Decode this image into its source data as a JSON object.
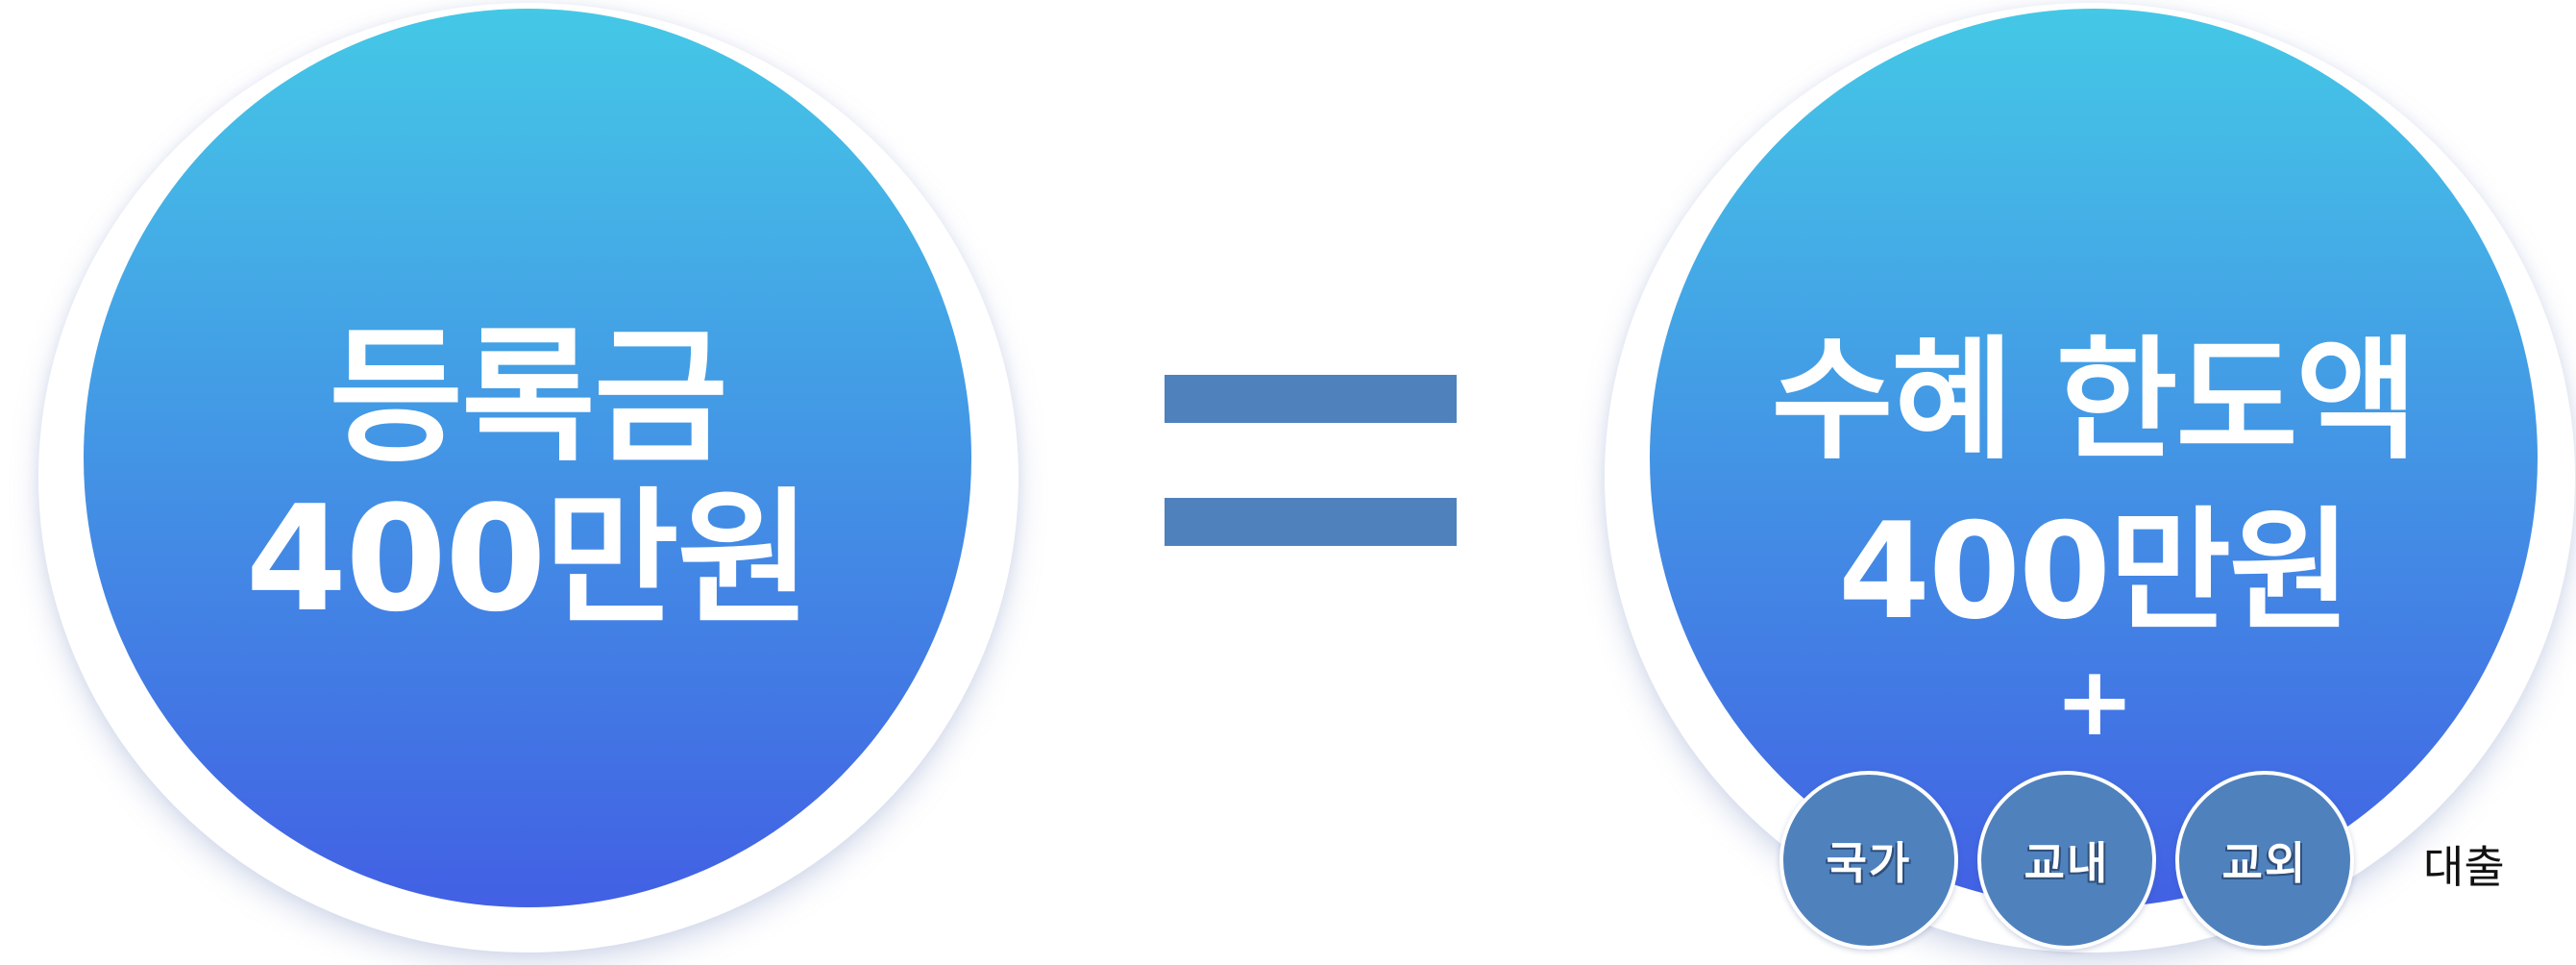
{
  "colors": {
    "gradient_top": "#44c8e6",
    "gradient_bottom": "#4260e4",
    "equals_bar": "#4f81bd",
    "small_circle": "#4f81bd"
  },
  "left_circle": {
    "line1": "등록금",
    "line2": "400만원"
  },
  "operator": {
    "symbol": "="
  },
  "right_circle": {
    "line1": "수혜 한도액",
    "line2": "400만원",
    "plus": "+"
  },
  "components": [
    {
      "label": "국가"
    },
    {
      "label": "교내"
    },
    {
      "label": "교외"
    }
  ],
  "suffix_label": "대출"
}
